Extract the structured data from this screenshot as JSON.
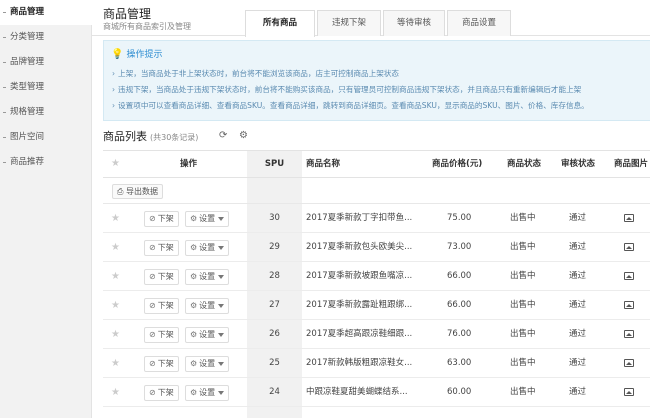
{
  "sidebar": {
    "items": [
      {
        "label": "商品管理",
        "active": true
      },
      {
        "label": "分类管理"
      },
      {
        "label": "品牌管理"
      },
      {
        "label": "类型管理"
      },
      {
        "label": "规格管理"
      },
      {
        "label": "图片空间"
      },
      {
        "label": "商品推荐"
      }
    ]
  },
  "header": {
    "title": "商品管理",
    "subtitle": "商城所有商品索引及管理",
    "tabs": [
      {
        "label": "所有商品",
        "active": true
      },
      {
        "label": "违规下架"
      },
      {
        "label": "等待审核"
      },
      {
        "label": "商品设置"
      }
    ]
  },
  "tips": {
    "title": "操作提示",
    "icon": "lightbulb-icon",
    "lines": [
      "上架，当商品处于非上架状态时，前台将不能浏览该商品，店主可控制商品上架状态",
      "违规下架，当商品处于违规下架状态时，前台将不能购买该商品，只有管理员可控制商品违规下架状态，并且商品只有重新编辑后才能上架",
      "设置项中可以查看商品详细、查看商品SKU。查看商品详细，跳转到商品详细页。查看商品SKU，显示商品的SKU、图片、价格、库存信息。"
    ]
  },
  "list": {
    "title": "商品列表",
    "count_text": "(共30条记录)",
    "refresh_icon": "refresh-icon",
    "settings_icon": "gear-icon",
    "export_label": "导出数据",
    "columns": {
      "star": "★",
      "operation": "操作",
      "spu": "SPU",
      "name": "商品名称",
      "price": "商品价格(元)",
      "status": "商品状态",
      "audit": "审核状态",
      "image": "商品图片"
    },
    "action_labels": {
      "off_shelf": "下架",
      "settings": "设置"
    },
    "rows": [
      {
        "spu": "30",
        "name": "2017夏季新款丁字扣带鱼...",
        "price": "75.00",
        "status": "出售中",
        "audit": "通过"
      },
      {
        "spu": "29",
        "name": "2017夏季新款包头欧美尖...",
        "price": "73.00",
        "status": "出售中",
        "audit": "通过"
      },
      {
        "spu": "28",
        "name": "2017夏季新款坡跟鱼嘴凉...",
        "price": "66.00",
        "status": "出售中",
        "audit": "通过"
      },
      {
        "spu": "27",
        "name": "2017夏季新款露趾粗跟绑...",
        "price": "66.00",
        "status": "出售中",
        "audit": "通过"
      },
      {
        "spu": "26",
        "name": "2017夏季超高跟凉鞋细跟...",
        "price": "76.00",
        "status": "出售中",
        "audit": "通过"
      },
      {
        "spu": "25",
        "name": "2017新款韩版粗跟凉鞋女...",
        "price": "63.00",
        "status": "出售中",
        "audit": "通过"
      },
      {
        "spu": "24",
        "name": "中跟凉鞋夏甜美蝴蝶结系...",
        "price": "60.00",
        "status": "出售中",
        "audit": "通过"
      }
    ]
  },
  "colors": {
    "accent": "#2e8dd1",
    "tip_bg": "#ebf5fa",
    "sidebar_bg": "#f2f2f2"
  }
}
